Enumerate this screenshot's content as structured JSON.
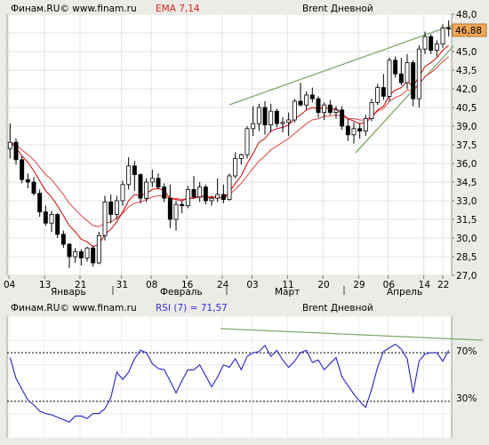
{
  "chart_data": [
    {
      "type": "candlestick",
      "watermark": "Финам.RU© www.finam.ru",
      "title": "Brent Дневной",
      "indicator_label": "EMA 7,14",
      "last_price_label": "46,88",
      "ylim": [
        27.0,
        48.0
      ],
      "y_ticks": [
        "48,0",
        "46,5",
        "45,0",
        "43,5",
        "42,0",
        "40,5",
        "39,0",
        "37,5",
        "36,0",
        "34,5",
        "33,0",
        "31,5",
        "30,0",
        "28,5",
        "27,0"
      ],
      "x_tick_labels": [
        "04",
        "13",
        "21",
        "31",
        "08",
        "16",
        "24",
        "03",
        "11",
        "20",
        "29",
        "06",
        "14",
        "22"
      ],
      "month_labels": [
        "Январь",
        "Февраль",
        "Март",
        "Апрель"
      ],
      "grid": true,
      "colors": {
        "bull": "#ffffff",
        "bear": "#000000",
        "ema_fast": "#d00000",
        "ema_slow": "#e04040",
        "trendline": "#7fa86a",
        "price_tag": "#f0a85a"
      },
      "candles": [
        [
          37.2,
          39.2,
          36.4,
          37.7
        ],
        [
          37.7,
          38.0,
          35.9,
          36.3
        ],
        [
          36.3,
          36.6,
          34.4,
          34.7
        ],
        [
          34.7,
          35.2,
          34.0,
          34.5
        ],
        [
          34.5,
          34.9,
          33.4,
          33.6
        ],
        [
          33.6,
          33.9,
          31.7,
          32.1
        ],
        [
          32.1,
          32.6,
          31.0,
          31.2
        ],
        [
          31.2,
          32.2,
          30.5,
          31.9
        ],
        [
          31.9,
          32.0,
          30.0,
          30.3
        ],
        [
          30.3,
          30.6,
          29.2,
          29.5
        ],
        [
          29.5,
          29.6,
          27.6,
          28.5
        ],
        [
          28.5,
          29.2,
          28.0,
          28.9
        ],
        [
          28.9,
          29.1,
          27.8,
          28.4
        ],
        [
          28.4,
          29.3,
          28.1,
          29.2
        ],
        [
          29.2,
          29.4,
          27.7,
          28.0
        ],
        [
          28.0,
          30.5,
          27.9,
          30.2
        ],
        [
          30.2,
          33.4,
          29.8,
          32.9
        ],
        [
          32.9,
          33.5,
          31.2,
          31.9
        ],
        [
          31.9,
          33.4,
          31.5,
          33.0
        ],
        [
          33.0,
          34.6,
          32.6,
          34.3
        ],
        [
          34.3,
          36.5,
          33.9,
          35.8
        ],
        [
          35.8,
          36.2,
          33.8,
          35.1
        ],
        [
          35.1,
          35.2,
          32.8,
          33.2
        ],
        [
          33.2,
          34.8,
          32.9,
          34.5
        ],
        [
          34.5,
          35.5,
          34.1,
          34.8
        ],
        [
          34.8,
          35.2,
          33.9,
          34.1
        ],
        [
          34.1,
          34.4,
          32.9,
          33.2
        ],
        [
          33.2,
          34.3,
          30.8,
          31.5
        ],
        [
          31.5,
          33.0,
          30.6,
          32.7
        ],
        [
          32.7,
          33.0,
          32.0,
          32.6
        ],
        [
          32.6,
          34.2,
          32.4,
          33.9
        ],
        [
          33.9,
          35.0,
          33.2,
          33.3
        ],
        [
          33.3,
          34.5,
          32.9,
          34.1
        ],
        [
          34.1,
          34.3,
          32.7,
          33.0
        ],
        [
          33.0,
          33.4,
          32.6,
          33.2
        ],
        [
          33.2,
          34.8,
          32.9,
          33.5
        ],
        [
          33.5,
          34.3,
          32.8,
          33.1
        ],
        [
          33.1,
          35.2,
          33.0,
          35.0
        ],
        [
          35.0,
          36.9,
          34.8,
          36.4
        ],
        [
          36.4,
          36.8,
          35.9,
          36.7
        ],
        [
          36.7,
          39.0,
          36.4,
          38.8
        ],
        [
          38.8,
          40.6,
          38.2,
          39.2
        ],
        [
          39.2,
          40.8,
          38.6,
          40.5
        ],
        [
          40.5,
          41.0,
          38.3,
          39.1
        ],
        [
          39.1,
          40.8,
          38.5,
          40.2
        ],
        [
          40.2,
          40.4,
          38.9,
          39.2
        ],
        [
          39.2,
          39.7,
          38.5,
          39.3
        ],
        [
          39.3,
          40.1,
          38.2,
          39.5
        ],
        [
          39.5,
          41.2,
          39.3,
          41.0
        ],
        [
          41.0,
          42.5,
          40.6,
          40.7
        ],
        [
          40.7,
          41.8,
          40.3,
          41.5
        ],
        [
          41.5,
          42.1,
          40.9,
          41.2
        ],
        [
          41.2,
          41.4,
          39.7,
          40.1
        ],
        [
          40.1,
          40.9,
          39.5,
          40.7
        ],
        [
          40.7,
          41.1,
          39.9,
          40.1
        ],
        [
          40.1,
          40.6,
          39.6,
          40.3
        ],
        [
          40.3,
          40.6,
          38.7,
          39.0
        ],
        [
          39.0,
          39.6,
          37.8,
          38.3
        ],
        [
          38.3,
          39.3,
          37.6,
          38.8
        ],
        [
          38.8,
          39.2,
          38.0,
          38.6
        ],
        [
          38.6,
          39.9,
          38.2,
          39.6
        ],
        [
          39.6,
          41.2,
          39.4,
          40.9
        ],
        [
          40.9,
          42.4,
          40.7,
          42.1
        ],
        [
          42.1,
          43.2,
          41.1,
          41.4
        ],
        [
          41.4,
          44.5,
          41.0,
          44.3
        ],
        [
          44.3,
          44.6,
          42.9,
          43.2
        ],
        [
          43.2,
          44.5,
          42.3,
          42.5
        ],
        [
          42.5,
          44.8,
          42.0,
          44.1
        ],
        [
          44.1,
          44.3,
          40.6,
          41.2
        ],
        [
          41.2,
          45.5,
          40.5,
          45.2
        ],
        [
          45.2,
          46.6,
          44.8,
          46.2
        ],
        [
          46.2,
          46.4,
          44.8,
          45.1
        ],
        [
          45.1,
          45.9,
          44.6,
          45.6
        ],
        [
          45.6,
          47.2,
          45.3,
          46.9
        ],
        [
          46.9,
          47.5,
          46.2,
          46.88
        ]
      ],
      "ema_fast": [
        37.7,
        37.3,
        36.6,
        36.1,
        35.4,
        34.6,
        33.8,
        33.3,
        32.6,
        31.8,
        31.0,
        30.5,
        29.9,
        29.7,
        29.3,
        29.5,
        30.3,
        30.7,
        31.3,
        32.1,
        33.0,
        33.5,
        33.4,
        33.6,
        33.9,
        34.0,
        33.8,
        33.2,
        33.1,
        33.0,
        33.2,
        33.2,
        33.4,
        33.3,
        33.3,
        33.3,
        33.2,
        33.7,
        34.4,
        35.0,
        36.0,
        36.8,
        37.7,
        38.0,
        38.6,
        38.8,
        38.9,
        39.1,
        39.6,
        39.9,
        40.3,
        40.5,
        40.4,
        40.5,
        40.4,
        40.4,
        40.0,
        39.6,
        39.4,
        39.2,
        39.3,
        39.7,
        40.3,
        40.6,
        41.5,
        41.9,
        42.1,
        42.6,
        42.2,
        43.0,
        43.8,
        44.1,
        44.5,
        45.1,
        45.5
      ],
      "ema_slow": [
        37.7,
        37.5,
        37.1,
        36.7,
        36.3,
        35.7,
        35.1,
        34.7,
        34.1,
        33.5,
        32.8,
        32.3,
        31.8,
        31.4,
        31.0,
        30.9,
        31.2,
        31.3,
        31.6,
        32.0,
        32.5,
        32.8,
        32.9,
        33.1,
        33.3,
        33.4,
        33.4,
        33.2,
        33.2,
        33.1,
        33.2,
        33.2,
        33.3,
        33.3,
        33.2,
        33.3,
        33.2,
        33.5,
        33.9,
        34.4,
        35.0,
        35.6,
        36.2,
        36.6,
        37.1,
        37.4,
        37.7,
        38.0,
        38.4,
        38.8,
        39.2,
        39.5,
        39.6,
        39.8,
        39.8,
        39.9,
        39.8,
        39.6,
        39.6,
        39.5,
        39.5,
        39.8,
        40.2,
        40.4,
        41.0,
        41.3,
        41.5,
        41.9,
        41.8,
        42.4,
        43.0,
        43.3,
        43.7,
        44.2,
        44.6
      ]
    },
    {
      "type": "line",
      "watermark": "Финам.RU© www.finam.ru",
      "title": "Brent Дневной",
      "indicator_label": "RSI (7) = 71,57",
      "ylim": [
        0,
        100
      ],
      "levels": [
        "70%",
        "30%"
      ],
      "level_values": [
        70,
        30
      ],
      "grid": true,
      "colors": {
        "line": "#2222cc",
        "trendline": "#7fa86a"
      },
      "values": [
        66,
        49,
        40,
        31,
        27,
        22,
        20,
        19,
        17,
        15,
        13,
        18,
        18,
        16,
        20,
        20,
        24,
        33,
        54,
        48,
        54,
        65,
        72,
        70,
        61,
        57,
        56,
        47,
        37,
        47,
        56,
        56,
        60,
        51,
        42,
        50,
        60,
        58,
        65,
        56,
        67,
        70,
        71,
        76,
        67,
        72,
        64,
        58,
        63,
        70,
        72,
        62,
        64,
        56,
        61,
        66,
        50,
        43,
        36,
        30,
        25,
        40,
        58,
        71,
        74,
        77,
        73,
        65,
        37,
        63,
        69,
        70,
        70,
        63,
        72
      ]
    }
  ]
}
